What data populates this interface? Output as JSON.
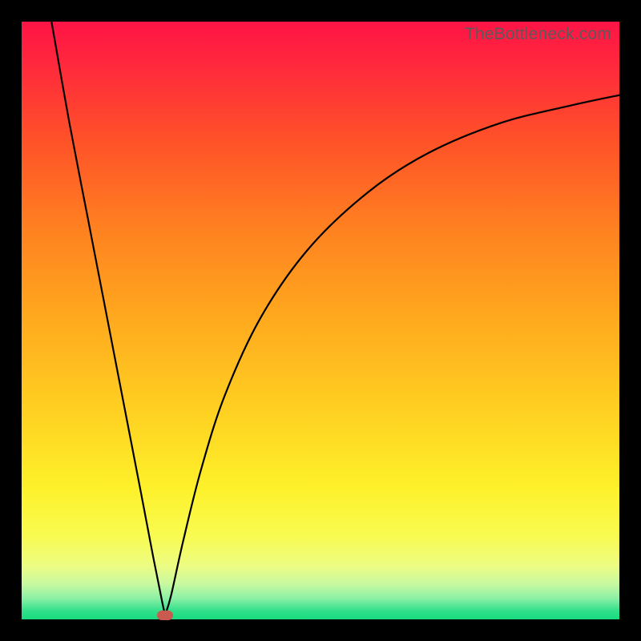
{
  "watermark": "TheBottleneck.com",
  "marker": {
    "x_pct": 24.0,
    "y_pct": 99.3,
    "color": "#c85a50"
  },
  "gradient_stops": [
    {
      "offset": 0.0,
      "color": "#ff1446"
    },
    {
      "offset": 0.08,
      "color": "#ff2b3b"
    },
    {
      "offset": 0.2,
      "color": "#ff5228"
    },
    {
      "offset": 0.35,
      "color": "#ff8220"
    },
    {
      "offset": 0.5,
      "color": "#ffaa1e"
    },
    {
      "offset": 0.65,
      "color": "#ffd021"
    },
    {
      "offset": 0.78,
      "color": "#fdf12a"
    },
    {
      "offset": 0.86,
      "color": "#f8fb50"
    },
    {
      "offset": 0.91,
      "color": "#edfc82"
    },
    {
      "offset": 0.94,
      "color": "#c9f9a0"
    },
    {
      "offset": 0.965,
      "color": "#8bf0a5"
    },
    {
      "offset": 0.985,
      "color": "#34e08c"
    },
    {
      "offset": 1.0,
      "color": "#17db7e"
    }
  ],
  "chart_data": {
    "type": "line",
    "title": "",
    "xlabel": "",
    "ylabel": "",
    "xlim": [
      0,
      100
    ],
    "ylim": [
      0,
      100
    ],
    "series": [
      {
        "name": "left-branch",
        "x": [
          5.0,
          8.0,
          11.0,
          14.0,
          17.0,
          20.0,
          22.0,
          23.5,
          24.0
        ],
        "values": [
          100.0,
          83.0,
          67.5,
          52.0,
          36.5,
          21.0,
          10.5,
          3.0,
          0.7
        ]
      },
      {
        "name": "right-branch",
        "x": [
          24.0,
          25.0,
          27.0,
          30.0,
          34.0,
          40.0,
          48.0,
          58.0,
          68.0,
          80.0,
          92.0,
          100.0
        ],
        "values": [
          0.7,
          4.0,
          13.0,
          25.0,
          37.5,
          50.5,
          62.0,
          71.5,
          78.0,
          83.0,
          86.0,
          87.7
        ]
      }
    ],
    "marker_point": {
      "x": 24.0,
      "y": 0.7
    }
  }
}
